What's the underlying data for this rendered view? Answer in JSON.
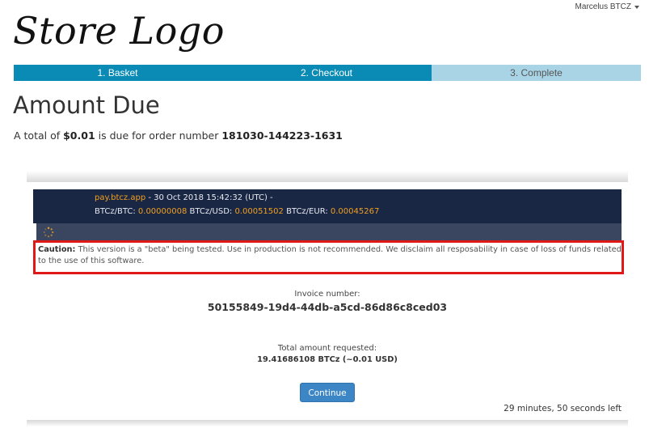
{
  "header": {
    "user_name": "Marcelus BTCZ",
    "logo_text": "Store Logo"
  },
  "steps": [
    {
      "label": "1. Basket",
      "state": "done"
    },
    {
      "label": "2. Checkout",
      "state": "done"
    },
    {
      "label": "3. Complete",
      "state": "todo"
    }
  ],
  "page": {
    "title": "Amount Due",
    "due_prefix": "A total of ",
    "amount": "$0.01",
    "due_middle": " is due for order number ",
    "order_number": "181030-144223-1631"
  },
  "widget": {
    "site": "pay.btcz.app",
    "date_text": " - 30 Oct 2018 15:42:32 (UTC)  - ",
    "btc_label": "BTCz/BTC: ",
    "btc_value": "0.00000008",
    "usd_label": " BTCz/USD: ",
    "usd_value": "0.00051502",
    "eur_label": " BTCz/EUR: ",
    "eur_value": "0.00045267",
    "caution_label": "Caution:",
    "caution_text": " This version is a \"beta\" being tested. Use in production is not recommended. We disclaim all resposability in case of loss of funds related to the use of this software.",
    "invoice_label": "Invoice number:",
    "invoice_number": "50155849-19d4-44db-a5cd-86d86c8ced03",
    "amount_label": "Total amount requested:",
    "amount_value": "19.41686108 BTCz (~0.01 USD)",
    "continue_label": "Continue",
    "time_left": "29 minutes, 50 seconds left"
  },
  "colors": {
    "step_done": "#0a8bb5",
    "step_todo": "#a8d4e6",
    "widget_header": "#1a2744",
    "caution_border": "#e01818",
    "button": "#3d86c6",
    "orange_values": "#f0a020"
  },
  "icons": {
    "user_menu_caret": "caret-down-icon",
    "loader": "spinner-icon"
  }
}
